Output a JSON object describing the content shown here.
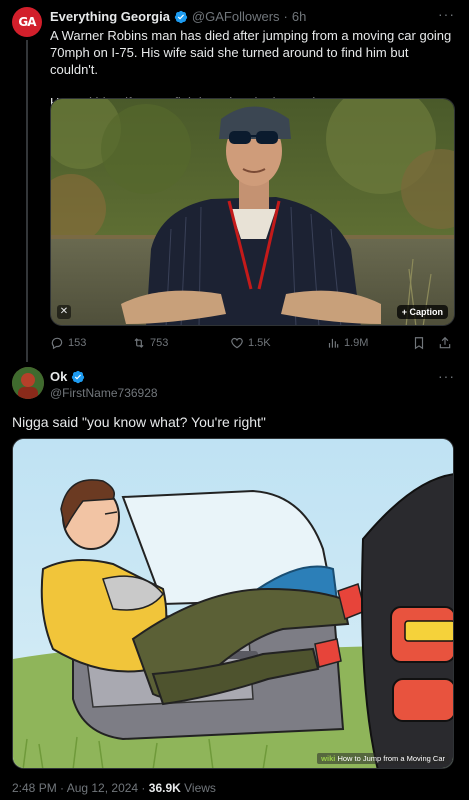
{
  "quoted_tweet": {
    "avatar_text": "GA",
    "display_name": "Everything Georgia",
    "handle": "@GAFollowers",
    "separator": "·",
    "time": "6h",
    "text_para1": "A Warner Robins man has died after jumping from a moving car going 70mph on I-75. His wife said she turned around to find him but couldn't.",
    "text_para2": "He and his wife were fighting when he jumped out.",
    "caption_label": "+ Caption",
    "stats": {
      "replies": "153",
      "reposts": "753",
      "likes": "1.5K",
      "views": "1.9M"
    }
  },
  "main_tweet": {
    "display_name": "Ok",
    "handle": "@FirstName736928",
    "text": "Nigga said \"you know what? You're right\"",
    "watermark_brand": "wiki",
    "watermark_text": "How to Jump from a Moving Car",
    "time": "2:48 PM · Aug 12, 2024 · ",
    "views_count": "36.9K",
    "views_label": " Views"
  },
  "colors": {
    "background": "#000000",
    "text_primary": "#e7e9ea",
    "text_muted": "#71767b",
    "verified_blue": "#1d9bf0",
    "avatar_red": "#d21f2b"
  },
  "icons": [
    "reply-icon",
    "retweet-icon",
    "like-icon",
    "views-icon",
    "bookmark-icon",
    "share-icon",
    "more-icon",
    "verified-icon",
    "alt-icon"
  ]
}
